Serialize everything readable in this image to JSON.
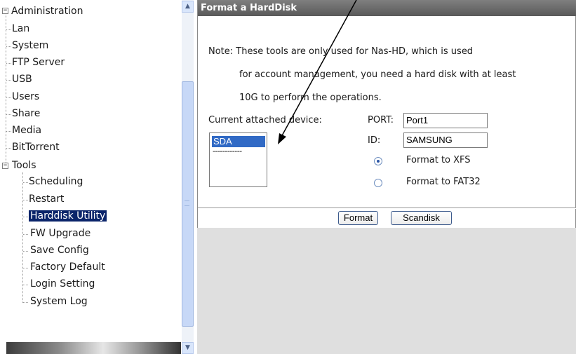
{
  "tree": {
    "root": "Administration",
    "items": [
      "Lan",
      "System",
      "FTP Server",
      "USB",
      "Users",
      "Share",
      "Media",
      "BitTorrent"
    ],
    "tools": "Tools",
    "tools_items": [
      "Scheduling",
      "Restart",
      "Harddisk Utility",
      "FW Upgrade",
      "Save Config",
      "Factory Default",
      "Login Setting",
      "System Log"
    ],
    "selected": "Harddisk Utility",
    "expander_glyph": "−"
  },
  "scrollbar": {
    "up_glyph": "▲",
    "down_glyph": "▼"
  },
  "panel": {
    "title": "Format a HardDisk",
    "note_line1": "Note: These tools are only used for Nas-HD, which is used",
    "note_line2": "for account management, you need a hard disk with at least",
    "note_line3": "10G to perform the operations.",
    "attached_label": "Current attached device:",
    "devices": [
      "SDA",
      "------------"
    ],
    "port_label": "PORT:",
    "port_value": "Port1",
    "id_label": "ID:",
    "id_value": "SAMSUNG",
    "options": [
      {
        "label": "Format to XFS",
        "checked": true
      },
      {
        "label": "Format to FAT32",
        "checked": false
      }
    ],
    "format_button": "Format",
    "scandisk_button": "Scandisk"
  },
  "colors": {
    "title_bar": "#595959",
    "selection": "#0a246a",
    "list_selection": "#316ac5",
    "workspace": "#dfdfdf"
  }
}
